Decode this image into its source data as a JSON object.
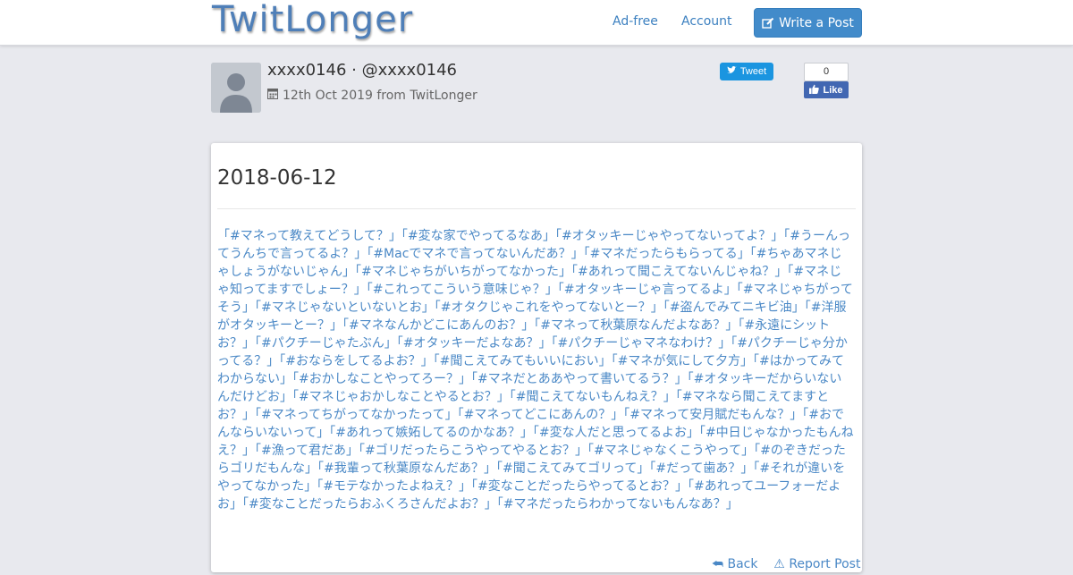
{
  "brand": {
    "logo_text": "TwitLonger"
  },
  "nav": {
    "adfree_label": "Ad-free",
    "account_label": "Account",
    "write_label": "Write a Post"
  },
  "author": {
    "display": "xxxx0146 · @xxxx0146",
    "date_source": "12th Oct 2019 from TwitLonger"
  },
  "social": {
    "tweet_label": "Tweet",
    "like_count": "0",
    "like_label": "Like"
  },
  "post": {
    "title": "2018-06-12",
    "body": "「#マネって教えてどうして？」「#変な家でやってるなあ」「#オタッキーじゃやってないってよ？」「#うーんってうんちで言ってるよ？」「#Macでマネで言ってないんだあ？」「#マネだったらもらってる」「#ちゃあマネじゃしょうがないじゃん」「#マネじゃちがいちがってなかった」「#あれって聞こえてないんじゃね？」「#マネじゃ知ってますでしょー？」「#これってこういう意味じゃ？」「#オタッキーじゃ言ってるよ」「#マネじゃちがってそう」「#マネじゃないといないとお」「#オタクじゃこれをやってないとー？」「#盗んでみてニキビ油」「#洋服がオタッキーとー？」「#マネなんかどこにあんのお？」「#マネって秋葉原なんだよなあ？」「#永遠にシットお？」「#パクチーじゃたぶん」「#オタッキーだよなあ？」「#パクチーじゃマネなわけ？」「#パクチーじゃ分かってる？」「#おならをしてるよお？」「#聞こえてみてもいいにおい」「#マネが気にして夕方」「#はかってみてわからない」「#おかしなことやってろー？」「#マネだとああやって書いてるう？」「#オタッキーだからいないんだけどお」「#マネじゃおかしなことやるとお？」「#聞こえてないもんねえ？」「#マネなら聞こえてますとお？」「#マネってちがってなかったって」「#マネってどこにあんの？」「#マネって安月賦だもんな？」「#おでんならいないって」「#あれって嫉妬してるのかなあ？」「#変な人だと思ってるよお」「#中日じゃなかったもんねえ？」「#漁って君だあ」「#ゴリだったらこうやってやるとお？」「#マネじゃなくこうやって」「#のぞきだったらゴリだもんな」「#我輩って秋葉原なんだあ？」「#聞こえてみてゴリって」「#だって歯あ？」「#それが違いをやってなかった」「#モテなかったよねえ？」「#変なことだったらやってるとお？」「#あれってユーフォーだよお」「#変なことだったらおふくろさんだよお？」「#マネだったらわかってないもんなあ？」",
    "back_label": "Back",
    "report_label": "Report Post"
  },
  "colors": {
    "accent": "#428bca",
    "link": "#4a88c6",
    "page_bg": "#e8e9ee",
    "tweet": "#1b95e0",
    "facebook": "#4267b2"
  },
  "icons": [
    "edit-icon",
    "calendar-icon",
    "twitter-bird-icon",
    "facebook-thumb-icon",
    "back-icon",
    "report-icon"
  ]
}
